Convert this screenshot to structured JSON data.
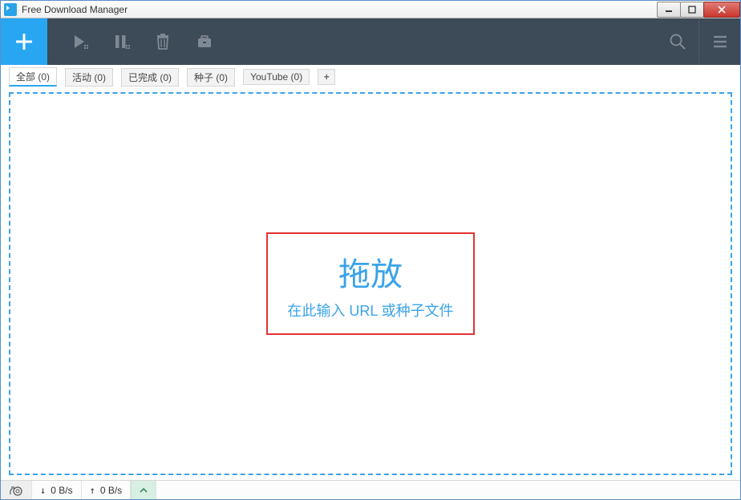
{
  "window": {
    "title": "Free Download Manager"
  },
  "toolbar": {
    "add": "+",
    "search": "search",
    "menu": "menu"
  },
  "tabs": [
    {
      "label": "全部 (0)",
      "active": true
    },
    {
      "label": "活动 (0)",
      "active": false
    },
    {
      "label": "已完成 (0)",
      "active": false
    },
    {
      "label": "种子 (0)",
      "active": false
    },
    {
      "label": "YouTube (0)",
      "active": false
    }
  ],
  "tab_plus": "+",
  "drop": {
    "title": "拖放",
    "subtitle": "在此输入 URL 或种子文件"
  },
  "status": {
    "down_label": "↓",
    "down_value": "0 B/s",
    "up_label": "↑",
    "up_value": "0 B/s"
  }
}
